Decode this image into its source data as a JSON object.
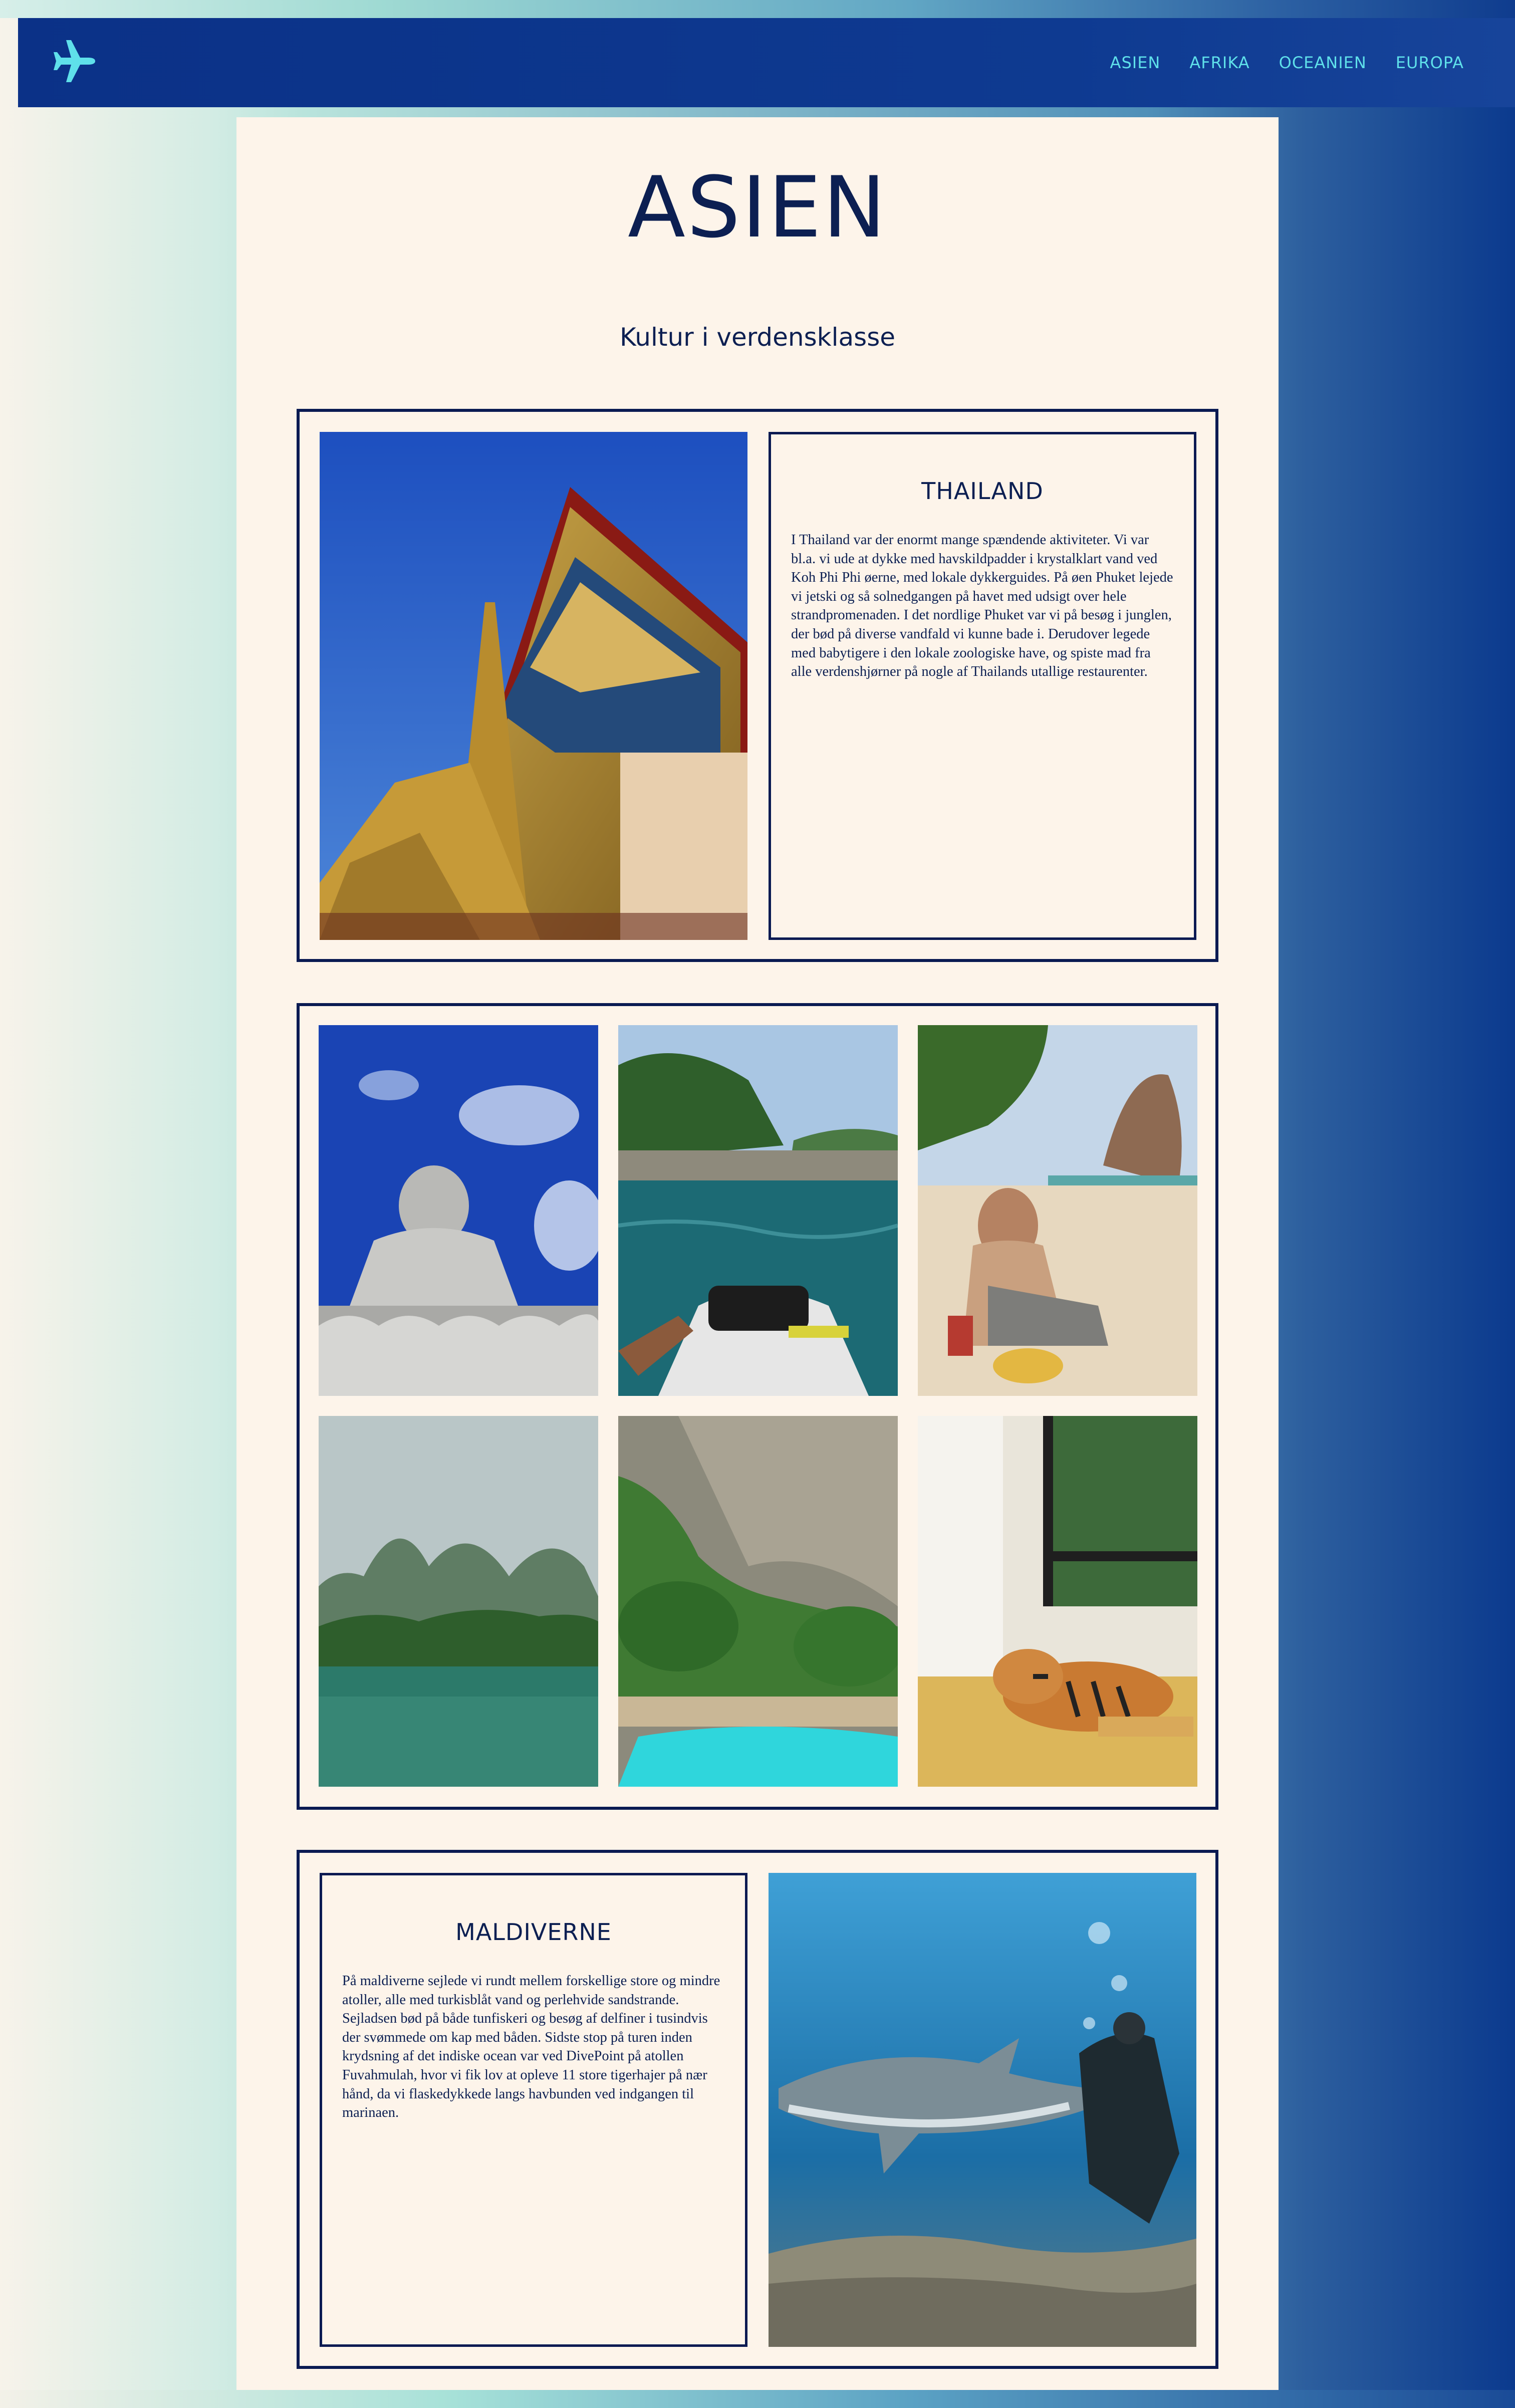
{
  "navbar": {
    "logo_icon": "airplane-icon",
    "links": [
      "ASIEN",
      "AFRIKA",
      "OCEANIEN",
      "EUROPA"
    ],
    "link_color": "#5fe0ea",
    "background": "#0b3187"
  },
  "page": {
    "title": "ASIEN",
    "subtitle": "Kultur i verdensklasse"
  },
  "thailand": {
    "title": "THAILAND",
    "text": "I Thailand var der enormt mange spændende aktiviteter. Vi var bl.a. vi ude at dykke med havskildpadder i krystalklart vand ved Koh Phi Phi øerne, med lokale dykkerguides. På øen Phuket lejede vi jetski og så solnedgangen på havet med udsigt over hele strandpromenaden. I det nordlige Phuket var vi på besøg i junglen, der bød på diverse vandfald vi kunne bade i. Derudover legede med babytigere i den lokale zoologiske have, og spiste mad fra alle verdenshjørner på nogle af Thailands utallige restaurenter."
  },
  "gallery": {
    "photos": [
      "big-buddha-photo",
      "jetski-photo",
      "beach-woman-photo",
      "karst-islands-photo",
      "jungle-pool-photo",
      "tiger-photo"
    ]
  },
  "maldiverne": {
    "title": "MALDIVERNE",
    "text": "På maldiverne sejlede vi rundt mellem forskellige store og mindre atoller, alle med turkisblåt vand og perlehvide sandstrande. Sejladsen bød på både tunfiskeri og besøg af delfiner i tusindvis der svømmede om kap med båden. Sidste stop på turen inden krydsning af det indiske ocean var ved DivePoint på atollen Fuvahmulah, hvor vi fik lov at opleve 11 store tigerhajer på nær hånd, da vi flaskedykkede langs havbunden ved indgangen til marinaen."
  },
  "colors": {
    "sheet": "#fdf4ea",
    "ink": "#0c1f52",
    "border": "#0a1a52"
  }
}
